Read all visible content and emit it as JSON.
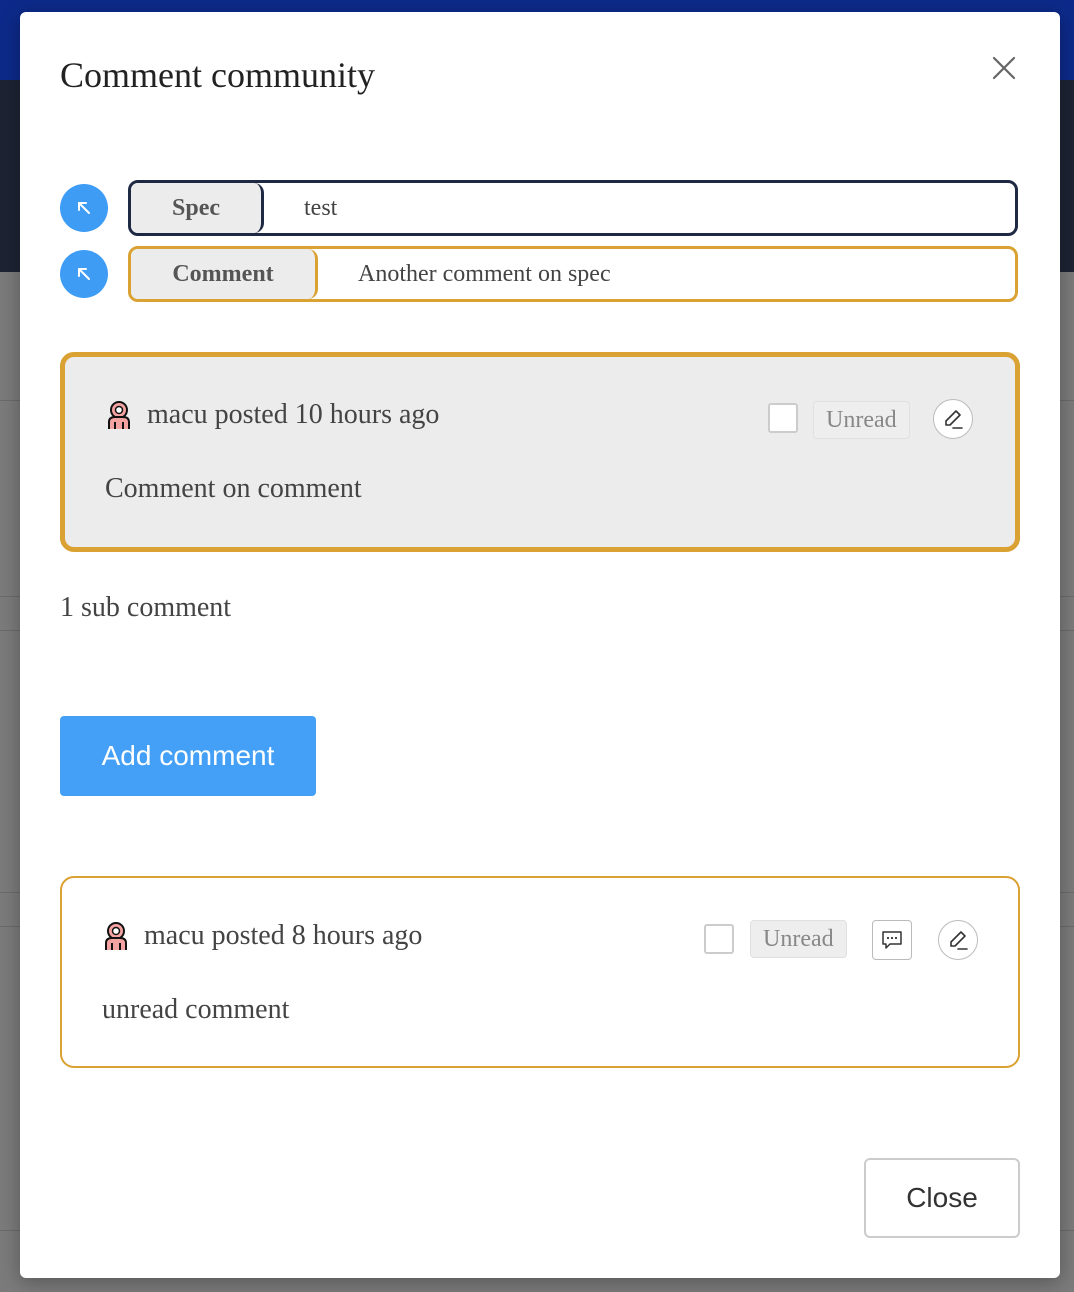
{
  "modal": {
    "title": "Comment community",
    "close_button_label": "Close"
  },
  "breadcrumbs": [
    {
      "tag": "Spec",
      "text": "test"
    },
    {
      "tag": "Comment",
      "text": "Another comment on spec"
    }
  ],
  "active_comment": {
    "author_line": "macu posted 10 hours ago",
    "status": "Unread",
    "body": "Comment on comment"
  },
  "sub_comment_count": "1 sub comment",
  "add_comment_label": "Add comment",
  "child_comment": {
    "author_line": "macu posted 8 hours ago",
    "status": "Unread",
    "body": "unread comment"
  },
  "colors": {
    "accent_blue": "#44a0f6",
    "highlight_gold": "#d9a232",
    "spec_border": "#1e2a44"
  }
}
